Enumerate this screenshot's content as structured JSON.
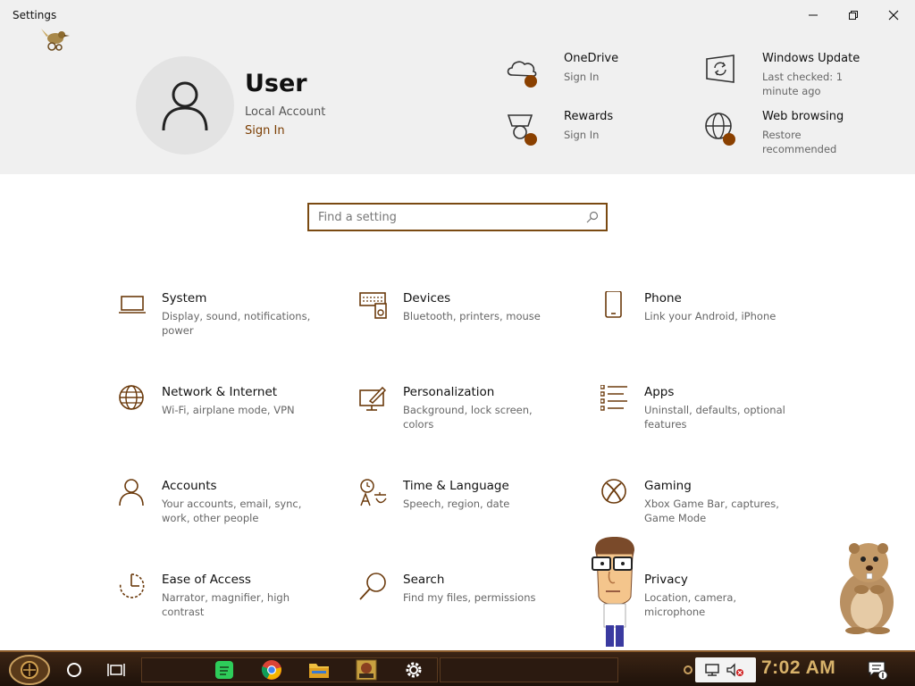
{
  "window": {
    "title": "Settings"
  },
  "profile": {
    "name": "User",
    "account_type": "Local Account",
    "sign_in": "Sign In"
  },
  "services": [
    {
      "title": "OneDrive",
      "subtitle": "Sign In",
      "icon": "onedrive-cloud-icon"
    },
    {
      "title": "Windows Update",
      "subtitle": "Last checked: 1 minute ago",
      "icon": "windows-update-icon"
    },
    {
      "title": "Rewards",
      "subtitle": "Sign In",
      "icon": "rewards-trophy-icon"
    },
    {
      "title": "Web browsing",
      "subtitle": "Restore recommended",
      "icon": "globe-icon"
    }
  ],
  "search": {
    "placeholder": "Find a setting"
  },
  "categories": [
    {
      "title": "System",
      "desc": "Display, sound, notifications, power",
      "icon": "laptop-icon"
    },
    {
      "title": "Devices",
      "desc": "Bluetooth, printers, mouse",
      "icon": "keyboard-speaker-icon"
    },
    {
      "title": "Phone",
      "desc": "Link your Android, iPhone",
      "icon": "phone-icon"
    },
    {
      "title": "Network & Internet",
      "desc": "Wi-Fi, airplane mode, VPN",
      "icon": "globe-icon"
    },
    {
      "title": "Personalization",
      "desc": "Background, lock screen, colors",
      "icon": "paintbrush-monitor-icon"
    },
    {
      "title": "Apps",
      "desc": "Uninstall, defaults, optional features",
      "icon": "list-icon"
    },
    {
      "title": "Accounts",
      "desc": "Your accounts, email, sync, work, other people",
      "icon": "person-icon"
    },
    {
      "title": "Time & Language",
      "desc": "Speech, region, date",
      "icon": "time-language-icon"
    },
    {
      "title": "Gaming",
      "desc": "Xbox Game Bar, captures, Game Mode",
      "icon": "xbox-icon"
    },
    {
      "title": "Ease of Access",
      "desc": "Narrator, magnifier, high contrast",
      "icon": "ease-of-access-icon"
    },
    {
      "title": "Search",
      "desc": "Find my files, permissions",
      "icon": "magnifier-icon"
    },
    {
      "title": "Privacy",
      "desc": "Location, camera, microphone",
      "icon": "lock-icon"
    }
  ],
  "taskbar": {
    "clock": "7:02 AM",
    "apps": [
      "cortana-icon",
      "task-view-icon",
      "spotify-icon",
      "chrome-icon",
      "file-explorer-icon",
      "game-app-icon",
      "settings-gear-icon"
    ]
  },
  "colors": {
    "accent": "#7a3c00",
    "icon_brown": "#6b3a0c",
    "badge": "#8a4000",
    "clock": "#d8b26a"
  }
}
